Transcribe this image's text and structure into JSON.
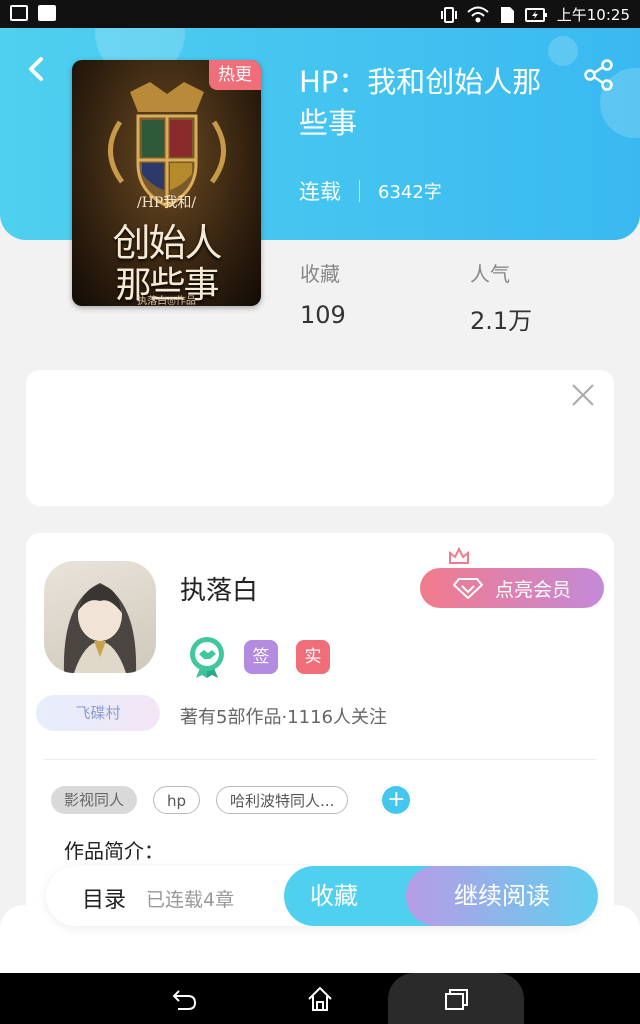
{
  "status_bar": {
    "time": "上午10:25"
  },
  "book": {
    "badge": "热更",
    "title": "HP：我和创始人那些事",
    "status": "连载",
    "word_count": "6342字",
    "cover": {
      "line1": "/HP我和/",
      "line2": "创始人",
      "line3": "那些事",
      "author_line": "执落白◎作品"
    }
  },
  "stats": [
    {
      "label": "收藏",
      "value": "109"
    },
    {
      "label": "人气",
      "value": "2.1万"
    }
  ],
  "author": {
    "name": "执落白",
    "village": "飞碟村",
    "badges": [
      {
        "text": "签",
        "color": "#b38be0"
      },
      {
        "text": "实",
        "color": "#f06e7a"
      }
    ],
    "info": "著有5部作品·1116人关注",
    "vip_button": "点亮会员"
  },
  "tags": [
    {
      "text": "影视同人",
      "style": "gray"
    },
    {
      "text": "hp",
      "style": "outline"
    },
    {
      "text": "哈利波特同人...",
      "style": "outline"
    }
  ],
  "intro_label": "作品简介：",
  "action_bar": {
    "toc": "目录",
    "chapters": "已连载4章",
    "favorite": "收藏",
    "read": "继续阅读"
  },
  "colors": {
    "accent": "#4fd0ef",
    "hot": "#f06e7a",
    "vip_start": "#f27a8c",
    "vip_end": "#c48ad8"
  }
}
